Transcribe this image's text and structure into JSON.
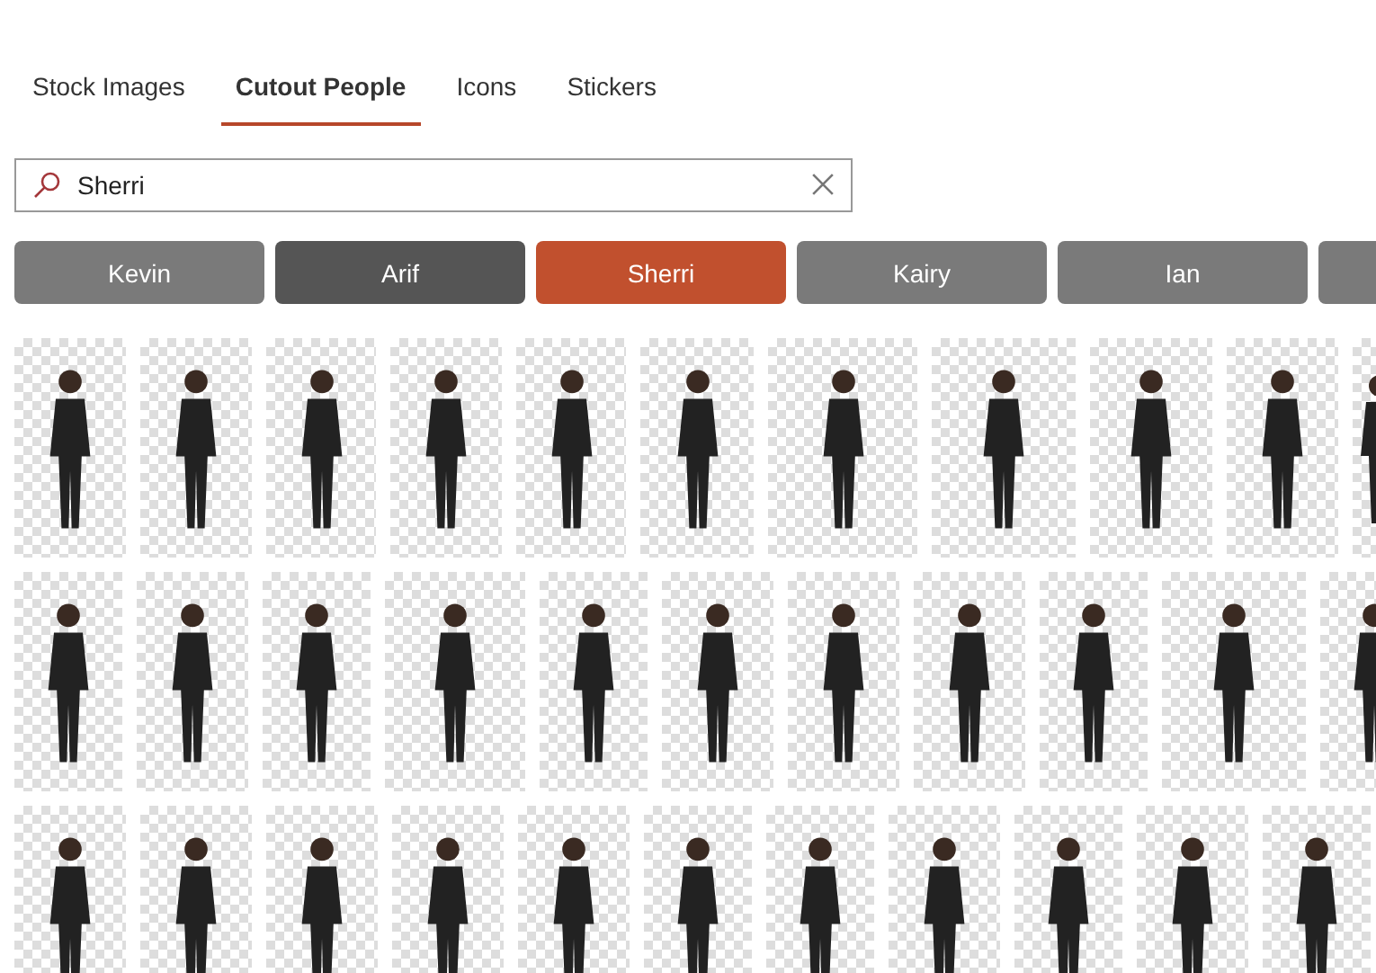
{
  "tabs": [
    {
      "label": "Stock Images",
      "selected": false
    },
    {
      "label": "Cutout People",
      "selected": true
    },
    {
      "label": "Icons",
      "selected": false
    },
    {
      "label": "Stickers",
      "selected": false
    }
  ],
  "search": {
    "value": "Sherri"
  },
  "people": [
    {
      "label": "Kevin",
      "selected": false,
      "hovered": false
    },
    {
      "label": "Arif",
      "selected": false,
      "hovered": true
    },
    {
      "label": "Sherri",
      "selected": true,
      "hovered": false
    },
    {
      "label": "Kairy",
      "selected": false,
      "hovered": false
    },
    {
      "label": "Ian",
      "selected": false,
      "hovered": false
    },
    {
      "selected": false,
      "hovered": false
    }
  ]
}
